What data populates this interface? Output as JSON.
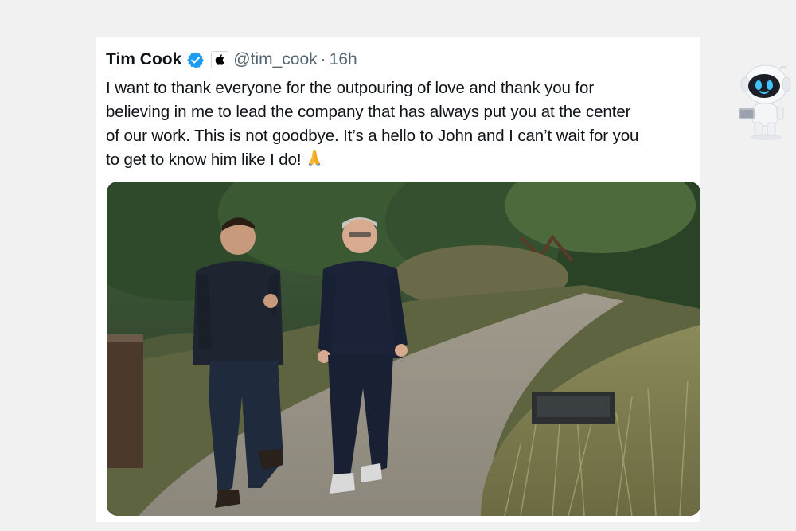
{
  "tweet": {
    "author": {
      "display_name": "Tim Cook",
      "handle": "@tim_cook",
      "verified_icon": "verified-badge-icon",
      "affiliation_icon": "apple-logo-icon"
    },
    "separator": "·",
    "timestamp": "16h",
    "text_lines": [
      "I want to thank everyone for the outpouring of love and thank you for",
      "believing in me to lead the company that has always put you at the center",
      "of our work. This is not goodbye. It’s a hello to John and I can’t wait for you",
      "to get to know him like I do!"
    ],
    "emoji_icon": "folded-hands-emoji-icon",
    "media": {
      "type": "photo"
    }
  },
  "overlay": {
    "mascot_icon": "robot-mascot-icon"
  },
  "colors": {
    "background": "#f1f1f1",
    "card": "#ffffff",
    "text_primary": "#0f1419",
    "text_secondary": "#536471",
    "verified_blue": "#1d9bf0"
  }
}
